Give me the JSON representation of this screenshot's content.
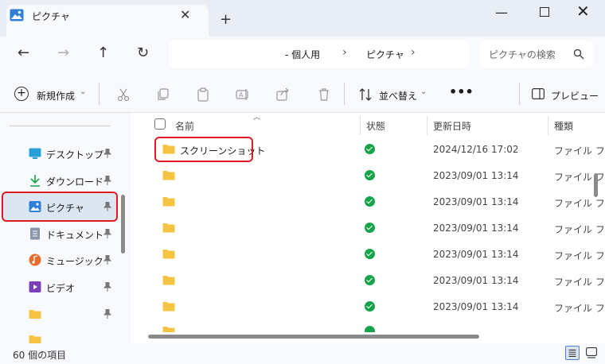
{
  "window": {
    "tab_title": "ピクチャ",
    "close_tab_glyph": "✕",
    "new_tab_glyph": "+",
    "minimize_glyph": "—",
    "close_glyph": "✕"
  },
  "navigation": {
    "back_glyph": "←",
    "forward_glyph": "→",
    "up_glyph": "↑",
    "refresh_glyph": "↻"
  },
  "address": {
    "breadcrumbs": [
      "- 個人用",
      "ピクチャ"
    ],
    "separator": "›"
  },
  "search": {
    "placeholder": "ピクチャの検索"
  },
  "toolbar": {
    "new_label": "新規作成",
    "sort_label": "並べ替え",
    "more_glyph": "•••",
    "preview_label": "プレビュー",
    "chevron": "⌄"
  },
  "sidebar": {
    "items": [
      {
        "label": "デスクトップ",
        "icon": "desktop-icon"
      },
      {
        "label": "ダウンロード",
        "icon": "download-icon"
      },
      {
        "label": "ピクチャ",
        "icon": "pictures-icon"
      },
      {
        "label": "ドキュメント",
        "icon": "documents-icon"
      },
      {
        "label": "ミュージック",
        "icon": "music-icon"
      },
      {
        "label": "ビデオ",
        "icon": "video-icon"
      },
      {
        "label": "",
        "icon": "folder-icon"
      },
      {
        "label": "",
        "icon": "folder-icon"
      }
    ]
  },
  "file_list": {
    "columns": [
      "名前",
      "状態",
      "更新日時",
      "種類"
    ],
    "rows": [
      {
        "name": "スクリーンショット",
        "date": "2024/12/16 17:02",
        "type": "ファイル フ"
      },
      {
        "name": "",
        "date": "2023/09/01 13:14",
        "type": "ファイル フ"
      },
      {
        "name": "",
        "date": "2023/09/01 13:14",
        "type": "ファイル フ"
      },
      {
        "name": "",
        "date": "2023/09/01 13:14",
        "type": "ファイル フ"
      },
      {
        "name": "",
        "date": "2023/09/01 13:14",
        "type": "ファイル フ"
      },
      {
        "name": "",
        "date": "2023/09/01 13:14",
        "type": "ファイル フ"
      },
      {
        "name": "",
        "date": "2023/09/01 13:14",
        "type": "ファイル フ"
      }
    ]
  },
  "status_bar": {
    "count": "60 個の項目"
  },
  "colors": {
    "highlight": "#e01b24",
    "folder": "#f6c443",
    "synced": "#16a34a",
    "selection": "#dce6f3"
  }
}
